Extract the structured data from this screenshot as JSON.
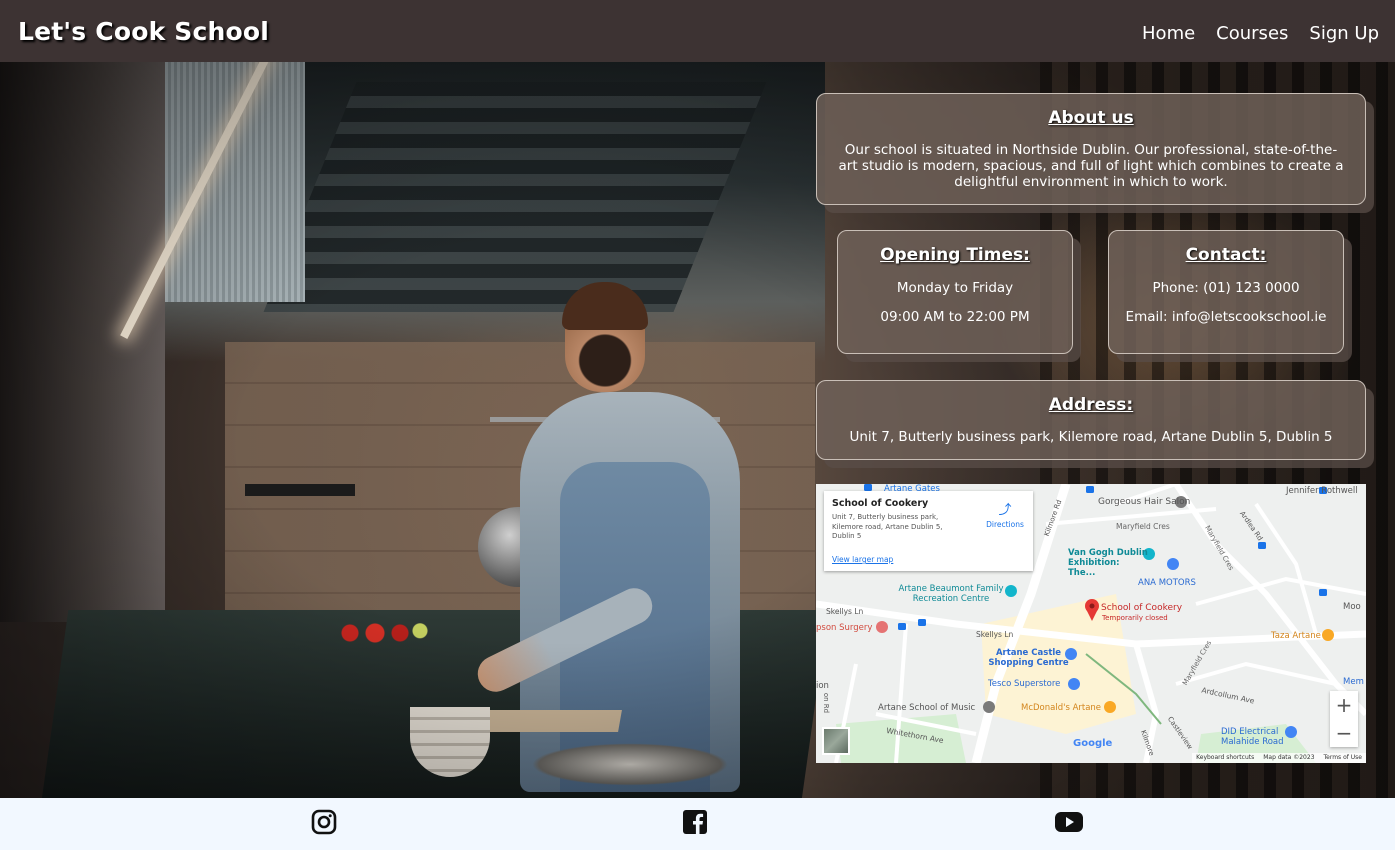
{
  "header": {
    "brand": "Let's Cook School",
    "nav": [
      "Home",
      "Courses",
      "Sign Up"
    ]
  },
  "about": {
    "title": "About us",
    "text": "Our school is situated in Northside Dublin. Our professional, state-of-the-art studio is modern, spacious, and full of light which combines to create a delightful environment in which to work."
  },
  "opening": {
    "title": "Opening Times:",
    "days": "Monday to Friday",
    "hours": "09:00 AM to 22:00 PM"
  },
  "contact": {
    "title": "Contact:",
    "phone": "Phone: (01) 123 0000",
    "email": "Email: info@letscookschool.ie"
  },
  "address": {
    "title": "Address:",
    "text": "Unit 7, Butterly business park, Kilemore road, Artane Dublin 5, Dublin 5"
  },
  "map": {
    "place_name": "School of Cookery",
    "place_address": "Unit 7, Butterly business park, Kilemore road, Artane Dublin 5, Dublin 5",
    "directions": "Directions",
    "larger_map": "View larger map",
    "zoom_in": "+",
    "zoom_out": "−",
    "footer": [
      "Keyboard shortcuts",
      "Map data ©2023",
      "Terms of Use"
    ],
    "google": "Google",
    "labels": {
      "gates": "Artane Gates",
      "salon": "Gorgeous Hair Salon",
      "rothwell": "Jennifer Rothwell",
      "maryfield": "Maryfield Cres",
      "vangogh": "Van Gogh Dublin Exhibition: The...",
      "anamotors": "ANA MOTORS",
      "beaumont": "Artane Beaumont Family Recreation Centre",
      "school": "School of Cookery",
      "closed": "Temporarily closed",
      "skellys": "Skellys Ln",
      "surgery": "pson Surgery",
      "skellys2": "Skellys Ln",
      "castle": "Artane Castle Shopping Centre",
      "tesco": "Tesco Superstore",
      "taza": "Taza Artane",
      "music": "Artane School of Music",
      "mcd": "McDonald's Artane",
      "whitethorn": "Whitethorn Ave",
      "ardcollum": "Ardcollum Ave",
      "did": "DID Electrical Malahide Road",
      "kilmore": "Kilmore Rd",
      "ardlea": "Ardlea Rd",
      "moo": "Moo",
      "mem": "Mem",
      "castleview": "Castleview",
      "kilmore2": "Kilmore",
      "ion": "ion",
      "ond": "on Rd",
      "maryfield2": "Maryfield Cres",
      "maryfield3": "Maryfield Cres"
    }
  },
  "social": {
    "icons": [
      "instagram-icon",
      "facebook-icon",
      "youtube-icon"
    ]
  },
  "colors": {
    "header_bg": "#3d3333",
    "footer_bg": "#f2f8ff",
    "panel_bg": "#6f6058",
    "map_pin": "#e53935"
  }
}
